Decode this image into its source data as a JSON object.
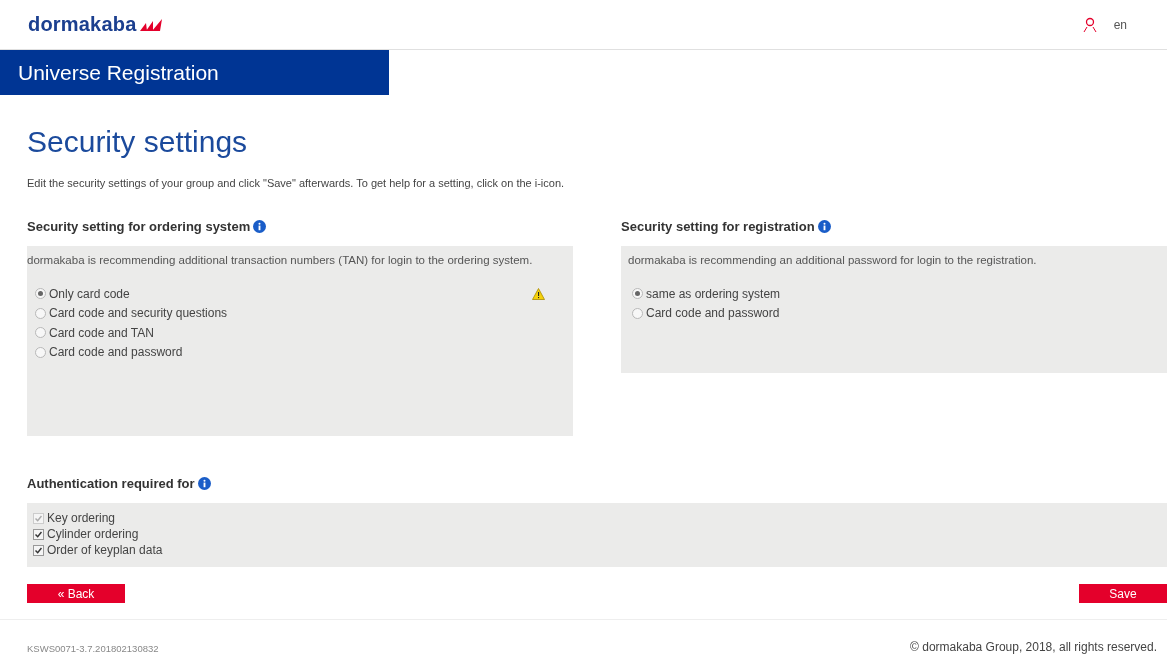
{
  "header": {
    "logo": "dormakaba",
    "language": "en"
  },
  "banner": {
    "title": "Universe Registration"
  },
  "page": {
    "title": "Security settings",
    "description": "Edit the security settings of your group and click \"Save\" afterwards. To get help for a setting, click on the i-icon."
  },
  "sections": [
    {
      "title": "Security setting for ordering system",
      "recommendation": "dormakaba is recommending additional transaction numbers (TAN) for login to the ordering system.",
      "options": [
        {
          "label": "Only card code",
          "selected": true,
          "warning": true
        },
        {
          "label": "Card code and security questions",
          "selected": false,
          "warning": false
        },
        {
          "label": "Card code and TAN",
          "selected": false,
          "warning": false
        },
        {
          "label": "Card code and password",
          "selected": false,
          "warning": false
        }
      ]
    },
    {
      "title": "Security setting for registration",
      "recommendation": "dormakaba is recommending an additional password for login to the registration.",
      "options": [
        {
          "label": "same as ordering system",
          "selected": true,
          "warning": false
        },
        {
          "label": "Card code and password",
          "selected": false,
          "warning": false
        }
      ]
    }
  ],
  "authentication": {
    "title": "Authentication required for",
    "items": [
      {
        "label": "Key ordering",
        "checked": true,
        "disabled": true
      },
      {
        "label": "Cylinder ordering",
        "checked": true,
        "disabled": false
      },
      {
        "label": "Order of keyplan data",
        "checked": true,
        "disabled": false
      }
    ]
  },
  "buttons": {
    "back": "« Back",
    "save": "Save"
  },
  "footer": {
    "version": "KSWS0071-3.7.201802130832",
    "copyright": "© dormakaba Group, 2018, all rights reserved."
  }
}
